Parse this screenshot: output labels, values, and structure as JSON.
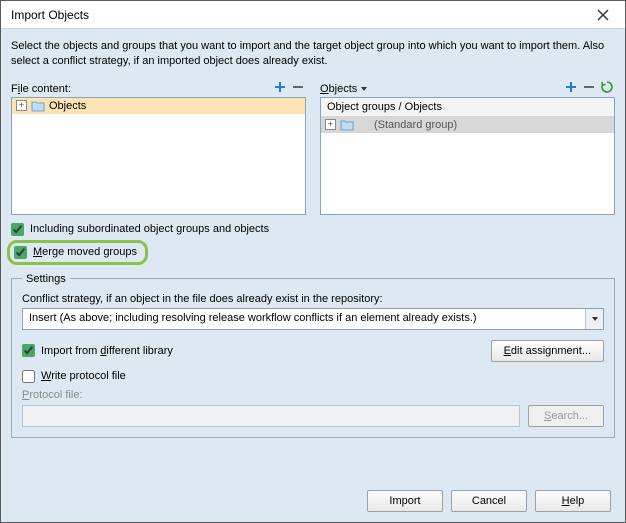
{
  "window": {
    "title": "Import Objects"
  },
  "description": "Select the objects and groups that you want to import and the target object group into which you want to import them. Also select a conflict strategy, if an imported object does already exist.",
  "left_pane": {
    "label_pre": "F",
    "label_u": "i",
    "label_post": "le content:",
    "item": "Objects"
  },
  "right_pane": {
    "label_pre": "",
    "label_u": "O",
    "label_post": "bjects",
    "header": "Object groups / Objects",
    "item_paren": "(Standard group)"
  },
  "checkboxes": {
    "subordinated": "Including subordinated object groups and objects",
    "merge_pre": "",
    "merge_u": "M",
    "merge_post": "erge moved groups",
    "import_diff_pre": "Import from ",
    "import_diff_u": "d",
    "import_diff_post": "ifferent library",
    "write_protocol_pre": "",
    "write_protocol_u": "W",
    "write_protocol_post": "rite protocol file"
  },
  "settings": {
    "legend": "Settings",
    "conflict_label": "Conflict strategy, if an object in the file does already exist in the repository:",
    "conflict_value": "Insert (As above; including resolving release workflow conflicts if an element already exists.)",
    "edit_assignment_pre": "",
    "edit_assignment_u": "E",
    "edit_assignment_post": "dit assignment...",
    "protocol_file_pre": "",
    "protocol_file_u": "P",
    "protocol_file_post": "rotocol file:",
    "search_pre": "",
    "search_u": "S",
    "search_post": "earch..."
  },
  "buttons": {
    "import": "Import",
    "cancel": "Cancel",
    "help_pre": "",
    "help_u": "H",
    "help_post": "elp"
  }
}
